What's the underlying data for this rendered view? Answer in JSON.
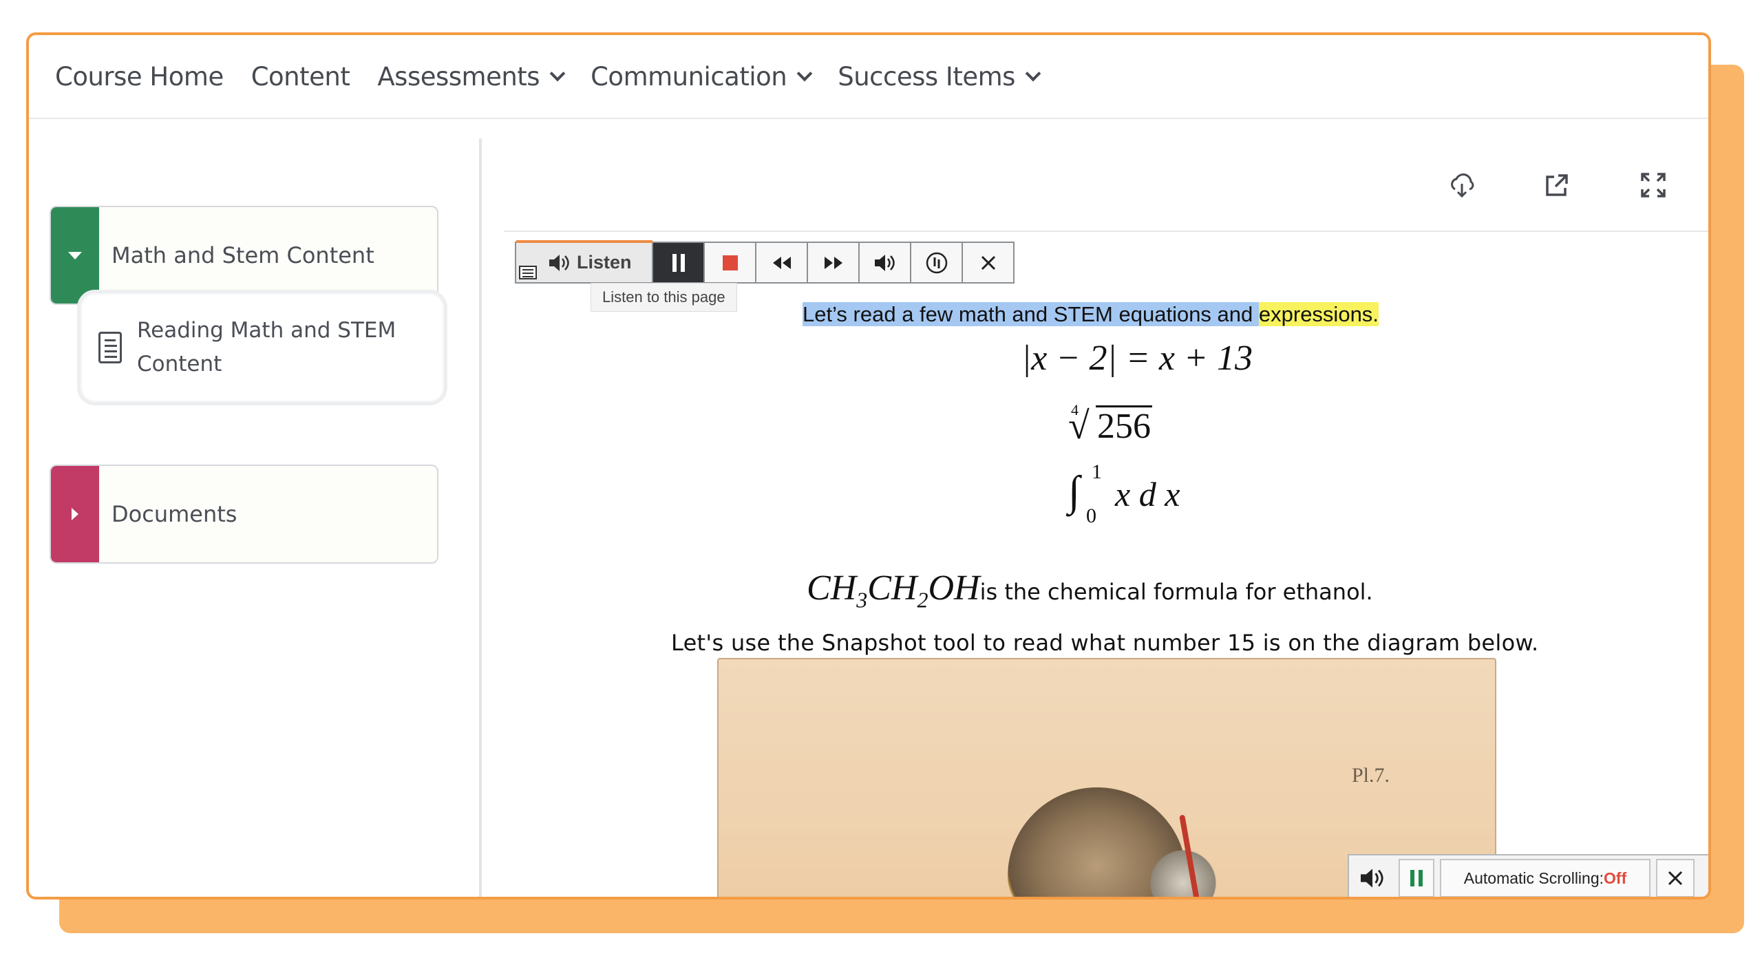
{
  "nav": {
    "items": [
      {
        "label": "Course Home",
        "has_dropdown": false
      },
      {
        "label": "Content",
        "has_dropdown": false
      },
      {
        "label": "Assessments",
        "has_dropdown": true
      },
      {
        "label": "Communication",
        "has_dropdown": true
      },
      {
        "label": "Success Items",
        "has_dropdown": true
      }
    ]
  },
  "sidebar": {
    "modules": [
      {
        "label": "Math and Stem Content",
        "color": "#2e8b57",
        "expanded": true
      },
      {
        "label": "Documents",
        "color": "#c23a66",
        "expanded": false
      }
    ],
    "topic": {
      "line1": "Reading Math and STEM",
      "line2": "Content",
      "icon": "document-icon"
    }
  },
  "toolbar_icons": [
    "cloud-download-icon",
    "open-external-icon",
    "fullscreen-icon"
  ],
  "readspeaker": {
    "listen_label": "Listen",
    "tooltip": "Listen to this page",
    "buttons": [
      "pause-icon",
      "stop-icon",
      "rewind-icon",
      "fast-forward-icon",
      "volume-icon",
      "settings-icon",
      "close-icon"
    ]
  },
  "content": {
    "sentence_part1": "Let’s read a few math and STEM equations and ",
    "sentence_part2": "expressions.",
    "eq1": "|x − 2| = x + 13",
    "eq2_index": "4",
    "eq2_radicand": "256",
    "eq3_lower": "0",
    "eq3_upper": "1",
    "eq3_body": "x d x",
    "formula_tail": " is the chemical formula for ethanol.",
    "snapshot_text": "Let's use the Snapshot tool to read what number 15 is on the diagram below.",
    "diagram_label": "Pl.7."
  },
  "reading_controls": {
    "auto_scroll_label": "Automatic Scrolling: ",
    "auto_scroll_state": "Off"
  },
  "colors": {
    "frame_border": "#f49c45",
    "highlight_sentence": "#a4c8f2",
    "highlight_word": "#f7f25e",
    "off_state": "#e04a3c"
  }
}
